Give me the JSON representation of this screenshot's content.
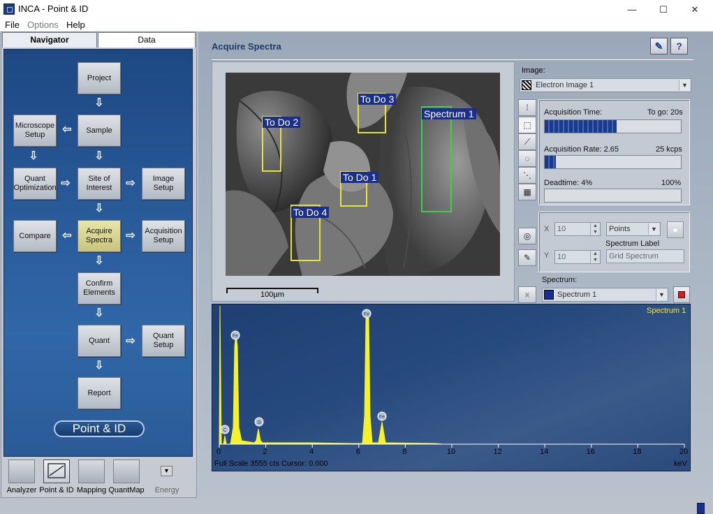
{
  "window": {
    "title": "INCA - Point & ID",
    "minimize_glyph": "—",
    "maximize_glyph": "☐",
    "close_glyph": "✕"
  },
  "menu": [
    "File",
    "Options",
    "Help"
  ],
  "left_tabs": [
    "Navigator",
    "Data"
  ],
  "navigator": {
    "project": "Project",
    "microscope_setup": "Microscope Setup",
    "sample": "Sample",
    "quant_optimization": "Quant Optimization",
    "site_of_interest": "Site of Interest",
    "image_setup": "Image Setup",
    "compare": "Compare",
    "acquire_spectra": "Acquire Spectra",
    "acquisition_setup": "Acquisition Setup",
    "confirm_elements": "Confirm Elements",
    "quant": "Quant",
    "quant_setup": "Quant Setup",
    "report": "Report",
    "mode_badge": "Point & ID"
  },
  "bottom_modes": [
    "Analyzer",
    "Point & ID",
    "Mapping",
    "QuantMap",
    "Energy"
  ],
  "section_title": "Acquire Spectra",
  "header_buttons": {
    "comment": "✎",
    "help": "?"
  },
  "image": {
    "label": "Image:",
    "selected": "Electron Image 1",
    "scale_label": "100µm",
    "rois": [
      {
        "label": "To Do  2",
        "color": "yellow"
      },
      {
        "label": "To Do  3",
        "color": "yellow"
      },
      {
        "label": "Spectrum 1",
        "color": "green"
      },
      {
        "label": "To Do  1",
        "color": "yellow"
      },
      {
        "label": "To Do  4",
        "color": "yellow"
      }
    ]
  },
  "acquisition": {
    "time_label": "Acquisition Time:",
    "to_go": "To go: 20s",
    "time_progress": 0.53,
    "rate_label": "Acquisition Rate: 2.65",
    "rate_max": "25 kcps",
    "rate_progress": 0.08,
    "deadtime_label": "Deadtime: 4%",
    "deadtime_max": "100%",
    "deadtime_progress": 0.0
  },
  "grid": {
    "x_label": "X",
    "x_value": "10",
    "y_label": "Y",
    "y_value": "10",
    "mode": "Points",
    "spectrum_label_caption": "Spectrum Label",
    "spectrum_label_value": "Grid Spectrum"
  },
  "spectrum_select": {
    "label": "Spectrum:",
    "selected": "Spectrum 1"
  },
  "spectrum": {
    "caption": "Spectrum 1",
    "footer": "Full Scale 3555 cts Cursor: 0.000",
    "unit": "keV",
    "ticks": [
      "0",
      "2",
      "4",
      "6",
      "8",
      "10",
      "12",
      "14",
      "16",
      "18",
      "20"
    ],
    "peak_labels": [
      "C",
      "Fe",
      "Si",
      "Fe",
      "Fe"
    ],
    "colors": {
      "trace": "#f6f22a",
      "caption": "#ffe92b"
    }
  }
}
